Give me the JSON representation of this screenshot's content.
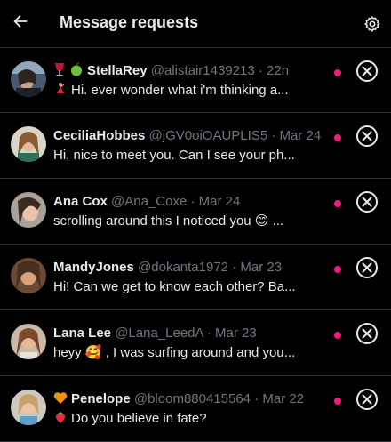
{
  "header": {
    "title": "Message requests",
    "back_icon": "arrow-left-icon",
    "settings_icon": "gear-icon"
  },
  "colors": {
    "background": "#000000",
    "text": "#e7e9ea",
    "muted": "#71767b",
    "divider": "#2f3336",
    "unread_dot": "#f91880"
  },
  "requests": [
    {
      "name": "StellaRey",
      "handle": "@alistair1439213",
      "time": "22h",
      "preview": "Hi. ever wonder what i'm thinking a...",
      "name_emojis": [
        "wine-glass-icon",
        "green-apple-icon"
      ],
      "preview_emoji": "dancer-icon",
      "unread": true
    },
    {
      "name": "CeciliaHobbes",
      "handle": "@jGV0oiOAUPLIS5",
      "time": "Mar 24",
      "preview": "Hi, nice to meet you. Can I see your ph...",
      "unread": true
    },
    {
      "name": "Ana Cox",
      "handle": "@Ana_Coxe",
      "time": "Mar 24",
      "preview": "scrolling around this I noticed you 😊 ...",
      "unread": true
    },
    {
      "name": "MandyJones",
      "handle": "@dokanta1972",
      "time": "Mar 23",
      "preview": "Hi! Can we get to know each other? Ba...",
      "unread": true
    },
    {
      "name": "Lana Lee",
      "handle": "@Lana_LeedA",
      "time": "Mar 23",
      "preview": "heyy 🥰 , I was surfing around and you...",
      "unread": true
    },
    {
      "name": "Penelope",
      "handle": "@bloom880415564",
      "time": "Mar 22",
      "preview": "Do you believe in fate?",
      "name_emojis": [
        "orange-heart-icon"
      ],
      "preview_emoji": "strawberry-icon",
      "unread": true
    }
  ],
  "separator": "·"
}
